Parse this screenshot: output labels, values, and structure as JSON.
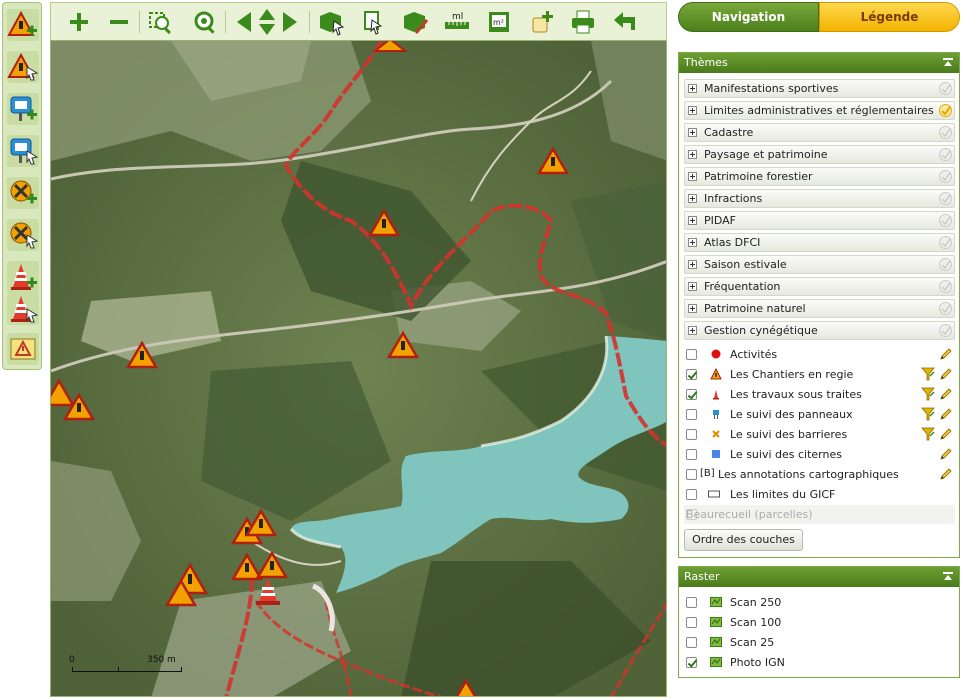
{
  "tabs": {
    "navigation": "Navigation",
    "legend": "Légende"
  },
  "themes_panel": {
    "title": "Thèmes",
    "themes": [
      {
        "label": "Manifestations sportives",
        "checked": false
      },
      {
        "label": "Limites administratives et réglementaires",
        "checked": true
      },
      {
        "label": "Cadastre",
        "checked": false
      },
      {
        "label": "Paysage et patrimoine",
        "checked": false
      },
      {
        "label": "Patrimoine forestier",
        "checked": false
      },
      {
        "label": "Infractions",
        "checked": false
      },
      {
        "label": "PIDAF",
        "checked": false
      },
      {
        "label": "Atlas DFCI",
        "checked": false
      },
      {
        "label": "Saison estivale",
        "checked": false
      },
      {
        "label": "Fréquentation",
        "checked": false
      },
      {
        "label": "Patrimoine naturel",
        "checked": false
      },
      {
        "label": "Gestion cynégétique",
        "checked": false
      }
    ],
    "layers": [
      {
        "label": "Activités",
        "checked": false,
        "symbol": "red-dot-icon",
        "filter": false,
        "edit": true,
        "enabled": true
      },
      {
        "label": "Les Chantiers en regie",
        "checked": true,
        "symbol": "roadwork-icon",
        "filter": true,
        "edit": true,
        "enabled": true
      },
      {
        "label": "Les travaux sous traites",
        "checked": true,
        "symbol": "traffic-cone-icon",
        "filter": true,
        "edit": true,
        "enabled": true
      },
      {
        "label": "Le suivi des panneaux",
        "checked": false,
        "symbol": "sign-panel-icon",
        "filter": true,
        "edit": true,
        "enabled": true
      },
      {
        "label": "Le suivi des barrieres",
        "checked": false,
        "symbol": "barrier-icon",
        "filter": true,
        "edit": true,
        "enabled": true
      },
      {
        "label": "Le suivi des citernes",
        "checked": false,
        "symbol": "blue-square-icon",
        "filter": false,
        "edit": true,
        "enabled": true
      },
      {
        "label": "Les annotations cartographiques",
        "checked": false,
        "symbol": "annotation-icon",
        "filter": false,
        "edit": true,
        "enabled": true
      },
      {
        "label": "Les limites du GICF",
        "checked": false,
        "symbol": "outline-rect-icon",
        "filter": false,
        "edit": false,
        "enabled": true
      },
      {
        "label": "Beaurecueil (parcelles)",
        "checked": false,
        "symbol": "",
        "filter": false,
        "edit": false,
        "enabled": false
      }
    ],
    "annotation_symbol_text": "[B]",
    "order_button": "Ordre des couches"
  },
  "raster_panel": {
    "title": "Raster",
    "layers": [
      {
        "label": "Scan 250",
        "checked": false
      },
      {
        "label": "Scan 100",
        "checked": false
      },
      {
        "label": "Scan 25",
        "checked": false
      },
      {
        "label": "Photo IGN",
        "checked": true
      }
    ]
  },
  "map": {
    "scale_zero": "0",
    "scale_label": "350 m"
  },
  "colors": {
    "accent_green": "#4c7f1c",
    "legend_tab": "#f2b300",
    "limit_line": "#d3322c",
    "lake": "#7fc5bd"
  }
}
